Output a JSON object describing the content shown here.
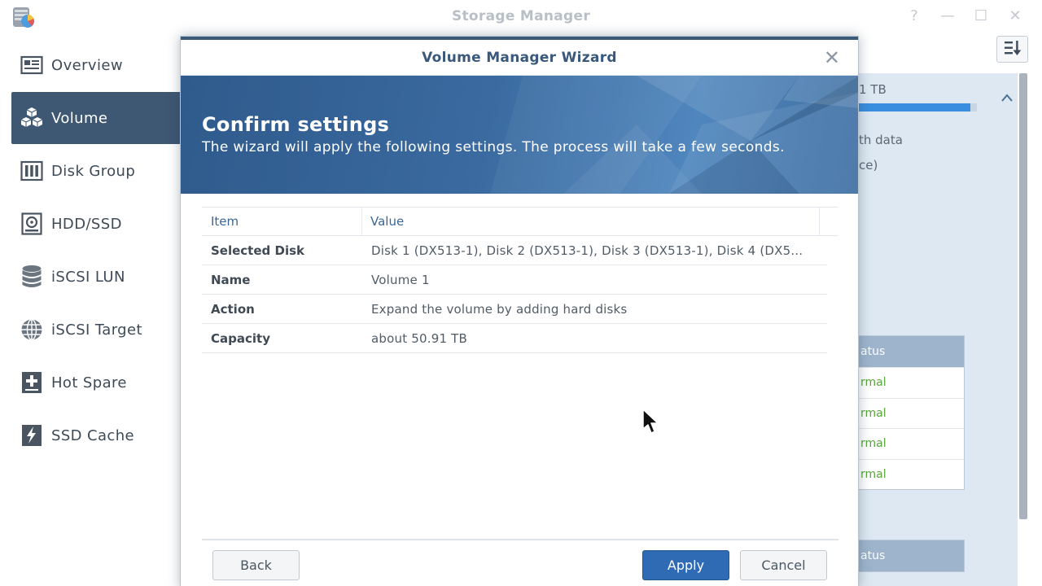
{
  "app": {
    "title": "Storage Manager"
  },
  "window_controls": {
    "help_glyph": "?",
    "minimize_glyph": "—",
    "maximize_glyph": "☐",
    "close_glyph": "✕"
  },
  "sidebar": {
    "items": [
      {
        "label": "Overview",
        "icon": "overview-icon",
        "active": false
      },
      {
        "label": "Volume",
        "icon": "cubes-icon",
        "active": true
      },
      {
        "label": "Disk Group",
        "icon": "disk-group-icon",
        "active": false
      },
      {
        "label": "HDD/SSD",
        "icon": "hdd-icon",
        "active": false
      },
      {
        "label": "iSCSI LUN",
        "icon": "database-icon",
        "active": false
      },
      {
        "label": "iSCSI Target",
        "icon": "globe-icon",
        "active": false
      },
      {
        "label": "Hot Spare",
        "icon": "plus-box-icon",
        "active": false
      },
      {
        "label": "SSD Cache",
        "icon": "lightning-icon",
        "active": false
      }
    ]
  },
  "background_panel": {
    "capacity_fragment": "1 TB",
    "usage_fraction": 0.95,
    "line_1": "th data",
    "line_2": "ce)",
    "table_1": {
      "header": "atus",
      "rows": [
        "rmal",
        "rmal",
        "rmal",
        "rmal"
      ]
    },
    "table_2": {
      "header": "atus"
    }
  },
  "dialog": {
    "title": "Volume Manager Wizard",
    "close_glyph": "✕",
    "banner": {
      "title": "Confirm settings",
      "subtitle": "The wizard will apply the following settings. The process will take a few seconds."
    },
    "table": {
      "columns": {
        "item": "Item",
        "value": "Value"
      },
      "rows": [
        {
          "item": "Selected Disk",
          "value": "Disk 1 (DX513-1), Disk 2 (DX513-1), Disk 3 (DX513-1), Disk 4 (DX5..."
        },
        {
          "item": "Name",
          "value": "Volume 1"
        },
        {
          "item": "Action",
          "value": "Expand the volume by adding hard disks"
        },
        {
          "item": "Capacity",
          "value": "about 50.91 TB"
        }
      ]
    },
    "buttons": {
      "back": "Back",
      "apply": "Apply",
      "cancel": "Cancel"
    }
  },
  "colors": {
    "sidebar_active": "#3e5773",
    "dialog_title": "#3a587a",
    "banner": "#3a6aa0",
    "primary_button": "#2f6bb5",
    "status_normal": "#58a73a"
  }
}
